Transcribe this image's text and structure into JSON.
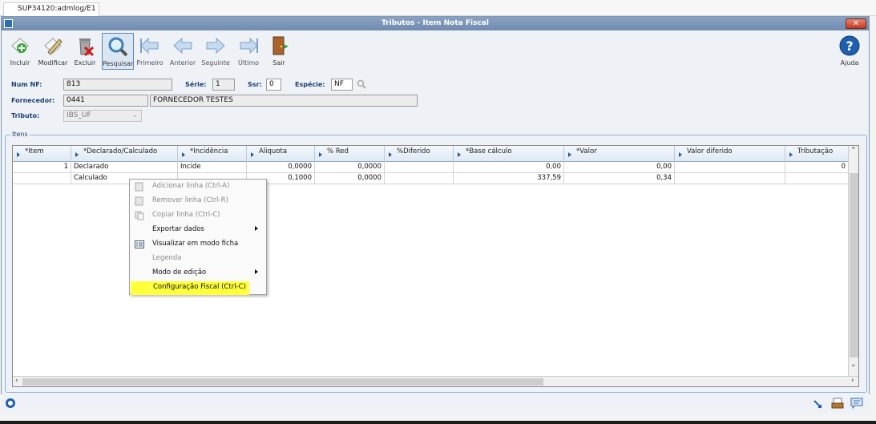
{
  "session_tab": "SUP34120:admlog/E1",
  "window": {
    "title": "Tributos - Item Nota Fiscal",
    "close_label": "✕"
  },
  "toolbar": {
    "incluir": "Incluir",
    "modificar": "Modificar",
    "excluir": "Excluir",
    "pesquisar": "Pesquisar",
    "primeiro": "Primeiro",
    "anterior": "Anterior",
    "seguinte": "Seguinte",
    "ultimo": "Último",
    "sair": "Sair",
    "ajuda": "Ajuda"
  },
  "form": {
    "num_nf_label": "Num NF:",
    "num_nf": "813",
    "serie_label": "Série:",
    "serie": "1",
    "ssr_label": "Ssr:",
    "ssr": "0",
    "especie_label": "Espécie:",
    "especie": "NF",
    "fornecedor_label": "Fornecedor:",
    "fornecedor_code": "0441",
    "fornecedor_name": "FORNECEDOR TESTES",
    "tributo_label": "Tributo:",
    "tributo": "IBS_UF"
  },
  "grid": {
    "group_label": "Itens",
    "columns": [
      "*Item",
      "*Declarado/Calculado",
      "*Incidência",
      "Aliquota",
      "% Red",
      "%Diferido",
      "*Base cálculo",
      "*Valor",
      "Valor diferido",
      "Tributação"
    ],
    "rows": [
      [
        "1",
        "Declarado",
        "Incide",
        "0,0000",
        "0,0000",
        "",
        "0,00",
        "0,00",
        "",
        "0"
      ],
      [
        "",
        "Calculado",
        "",
        "0,1000",
        "0,0000",
        "",
        "337,59",
        "0,34",
        "",
        ""
      ]
    ]
  },
  "context_menu": {
    "items": [
      {
        "label": "Adicionar linha (Ctrl-A)"
      },
      {
        "label": "Remover linha (Ctrl-R)"
      },
      {
        "label": "Copiar linha (Ctrl-C)"
      },
      {
        "label": "Exportar dados"
      },
      {
        "label": "Visualizar em modo ficha"
      },
      {
        "label": "Legenda"
      },
      {
        "label": "Modo de edição"
      },
      {
        "label": "Configuração Fiscal (Ctrl-C)"
      }
    ]
  },
  "colors": {
    "highlight": "#ffff3c",
    "title_bar": "#7a94b8",
    "header_text": "#1d3f73"
  }
}
